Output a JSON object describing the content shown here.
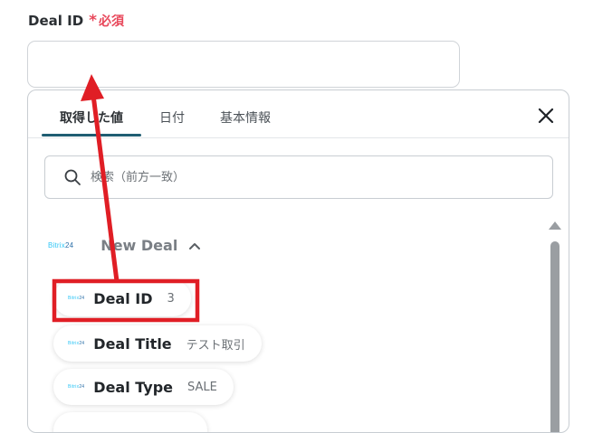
{
  "field": {
    "label": "Deal ID",
    "required_star": "*",
    "required_text": "必須",
    "value": ""
  },
  "tabs": [
    {
      "label": "取得した値",
      "active": true
    },
    {
      "label": "日付",
      "active": false
    },
    {
      "label": "基本情報",
      "active": false
    }
  ],
  "search": {
    "placeholder": "検索（前方一致）"
  },
  "section": {
    "logo_text": "Bitrix",
    "logo_num": "24",
    "title": "New Deal"
  },
  "items": [
    {
      "name": "Deal ID",
      "value": "3"
    },
    {
      "name": "Deal Title",
      "value": "テスト取引"
    },
    {
      "name": "Deal Type",
      "value": "SALE"
    }
  ],
  "colors": {
    "required": "#e8475a",
    "tab_underline": "#1f5d72",
    "highlight": "#e01e25",
    "bitrix_brand": "#2fc6f6"
  }
}
